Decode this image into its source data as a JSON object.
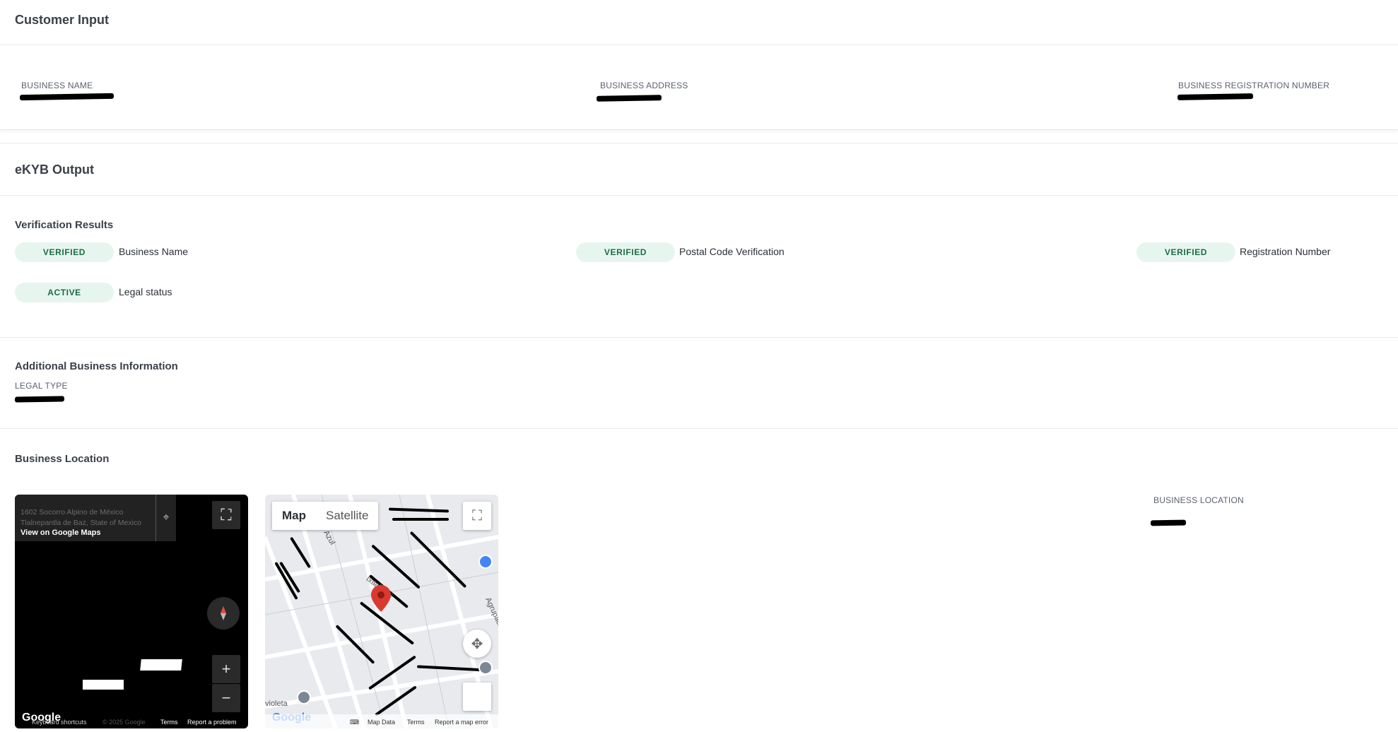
{
  "customer_input": {
    "title": "Customer Input",
    "fields": [
      {
        "label": "BUSINESS NAME"
      },
      {
        "label": "BUSINESS ADDRESS"
      },
      {
        "label": "BUSINESS REGISTRATION NUMBER"
      }
    ]
  },
  "ekyb": {
    "title": "eKYB Output",
    "verification": {
      "title": "Verification Results",
      "items": [
        {
          "status": "VERIFIED",
          "label": "Business Name"
        },
        {
          "status": "VERIFIED",
          "label": "Postal Code Verification"
        },
        {
          "status": "VERIFIED",
          "label": "Registration Number"
        },
        {
          "status": "ACTIVE",
          "label": "Legal status"
        }
      ]
    },
    "additional": {
      "title": "Additional Business Information",
      "legal_type_label": "LEGAL TYPE"
    },
    "location": {
      "title": "Business Location",
      "location_label": "BUSINESS LOCATION",
      "street_view": {
        "address_line1": "1602 Socorro Alpino de México",
        "address_line2": "Tlalnepantla de Baz, State of Mexico",
        "view_link": "View on Google Maps",
        "footer_shortcuts": "Keyboard shortcuts",
        "footer_copyright": "© 2025 Google",
        "footer_terms": "Terms",
        "footer_report": "Report a problem",
        "google_logo": "Google"
      },
      "map": {
        "tab_map": "Map",
        "tab_satellite": "Satellite",
        "footer_data": "Map Data",
        "footer_terms": "Terms",
        "footer_report": "Report a map error",
        "google_logo": "Google",
        "labels": [
          "violeta",
          "Agrupaci",
          "Ixtlahuac",
          "Azul"
        ]
      }
    }
  },
  "colors": {
    "pill_bg": "#e6f6ef",
    "pill_text": "#1d6b44",
    "map_pin": "#d93a2f"
  }
}
